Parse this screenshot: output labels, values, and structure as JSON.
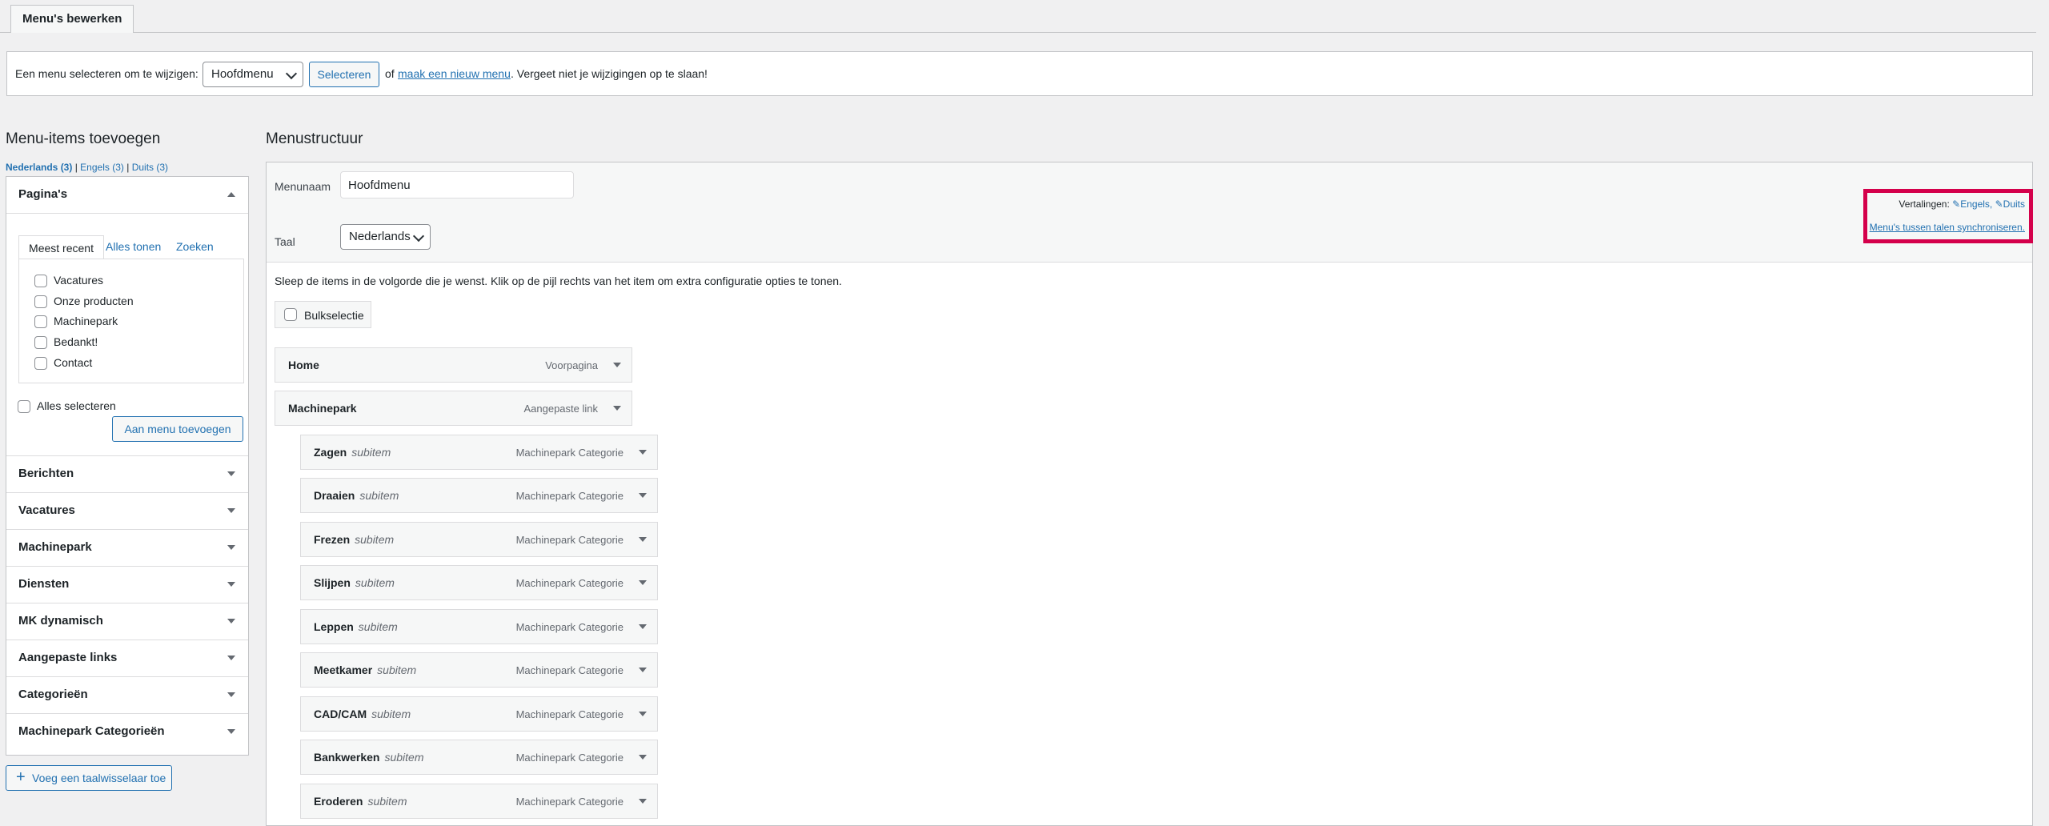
{
  "tab": "Menu's bewerken",
  "select_bar": {
    "prefix": "Een menu selecteren om te wijzigen:",
    "selected_menu": "Hoofdmenu",
    "select_button": "Selecteren",
    "or": "of",
    "new_menu_link": "maak een nieuw menu",
    "suffix": ". Vergeet niet je wijzigingen op te slaan!"
  },
  "left": {
    "title": "Menu-items toevoegen",
    "languages": {
      "active": "Nederlands (3)",
      "sep": "|",
      "en": "Engels (3)",
      "de": "Duits (3)"
    },
    "pages": {
      "title": "Pagina's",
      "tabs": [
        "Meest recent",
        "Alles tonen",
        "Zoeken"
      ],
      "items": [
        "Vacatures",
        "Onze producten",
        "Machinepark",
        "Bedankt!",
        "Contact"
      ],
      "select_all": "Alles selecteren",
      "add_button": "Aan menu toevoegen"
    },
    "sections": [
      "Berichten",
      "Vacatures",
      "Machinepark",
      "Diensten",
      "MK dynamisch",
      "Aangepaste links",
      "Categorieën",
      "Machinepark Categorieën"
    ],
    "lang_switch_button": "Voeg een taalwisselaar toe"
  },
  "right": {
    "title": "Menustructuur",
    "name_label": "Menunaam",
    "name_value": "Hoofdmenu",
    "lang_label": "Taal",
    "lang_value": "Nederlands",
    "translations": {
      "label": "Vertalingen:",
      "en": "Engels,",
      "de": "Duits",
      "sync": "Menu's tussen talen synchroniseren."
    },
    "instructions": "Sleep de items in de volgorde die je wenst. Klik op de pijl rechts van het item om extra configuratie opties te tonen.",
    "bulk": "Bulkselectie",
    "items": [
      {
        "title": "Home",
        "sub": "",
        "type": "Voorpagina"
      },
      {
        "title": "Machinepark",
        "sub": "",
        "type": "Aangepaste link"
      },
      {
        "title": "Zagen",
        "sub": "subitem",
        "type": "Machinepark Categorie"
      },
      {
        "title": "Draaien",
        "sub": "subitem",
        "type": "Machinepark Categorie"
      },
      {
        "title": "Frezen",
        "sub": "subitem",
        "type": "Machinepark Categorie"
      },
      {
        "title": "Slijpen",
        "sub": "subitem",
        "type": "Machinepark Categorie"
      },
      {
        "title": "Leppen",
        "sub": "subitem",
        "type": "Machinepark Categorie"
      },
      {
        "title": "Meetkamer",
        "sub": "subitem",
        "type": "Machinepark Categorie"
      },
      {
        "title": "CAD/CAM",
        "sub": "subitem",
        "type": "Machinepark Categorie"
      },
      {
        "title": "Bankwerken",
        "sub": "subitem",
        "type": "Machinepark Categorie"
      },
      {
        "title": "Eroderen",
        "sub": "subitem",
        "type": "Machinepark Categorie"
      }
    ]
  },
  "colors": {
    "accent": "#2271b1",
    "highlight": "#d4004b"
  }
}
